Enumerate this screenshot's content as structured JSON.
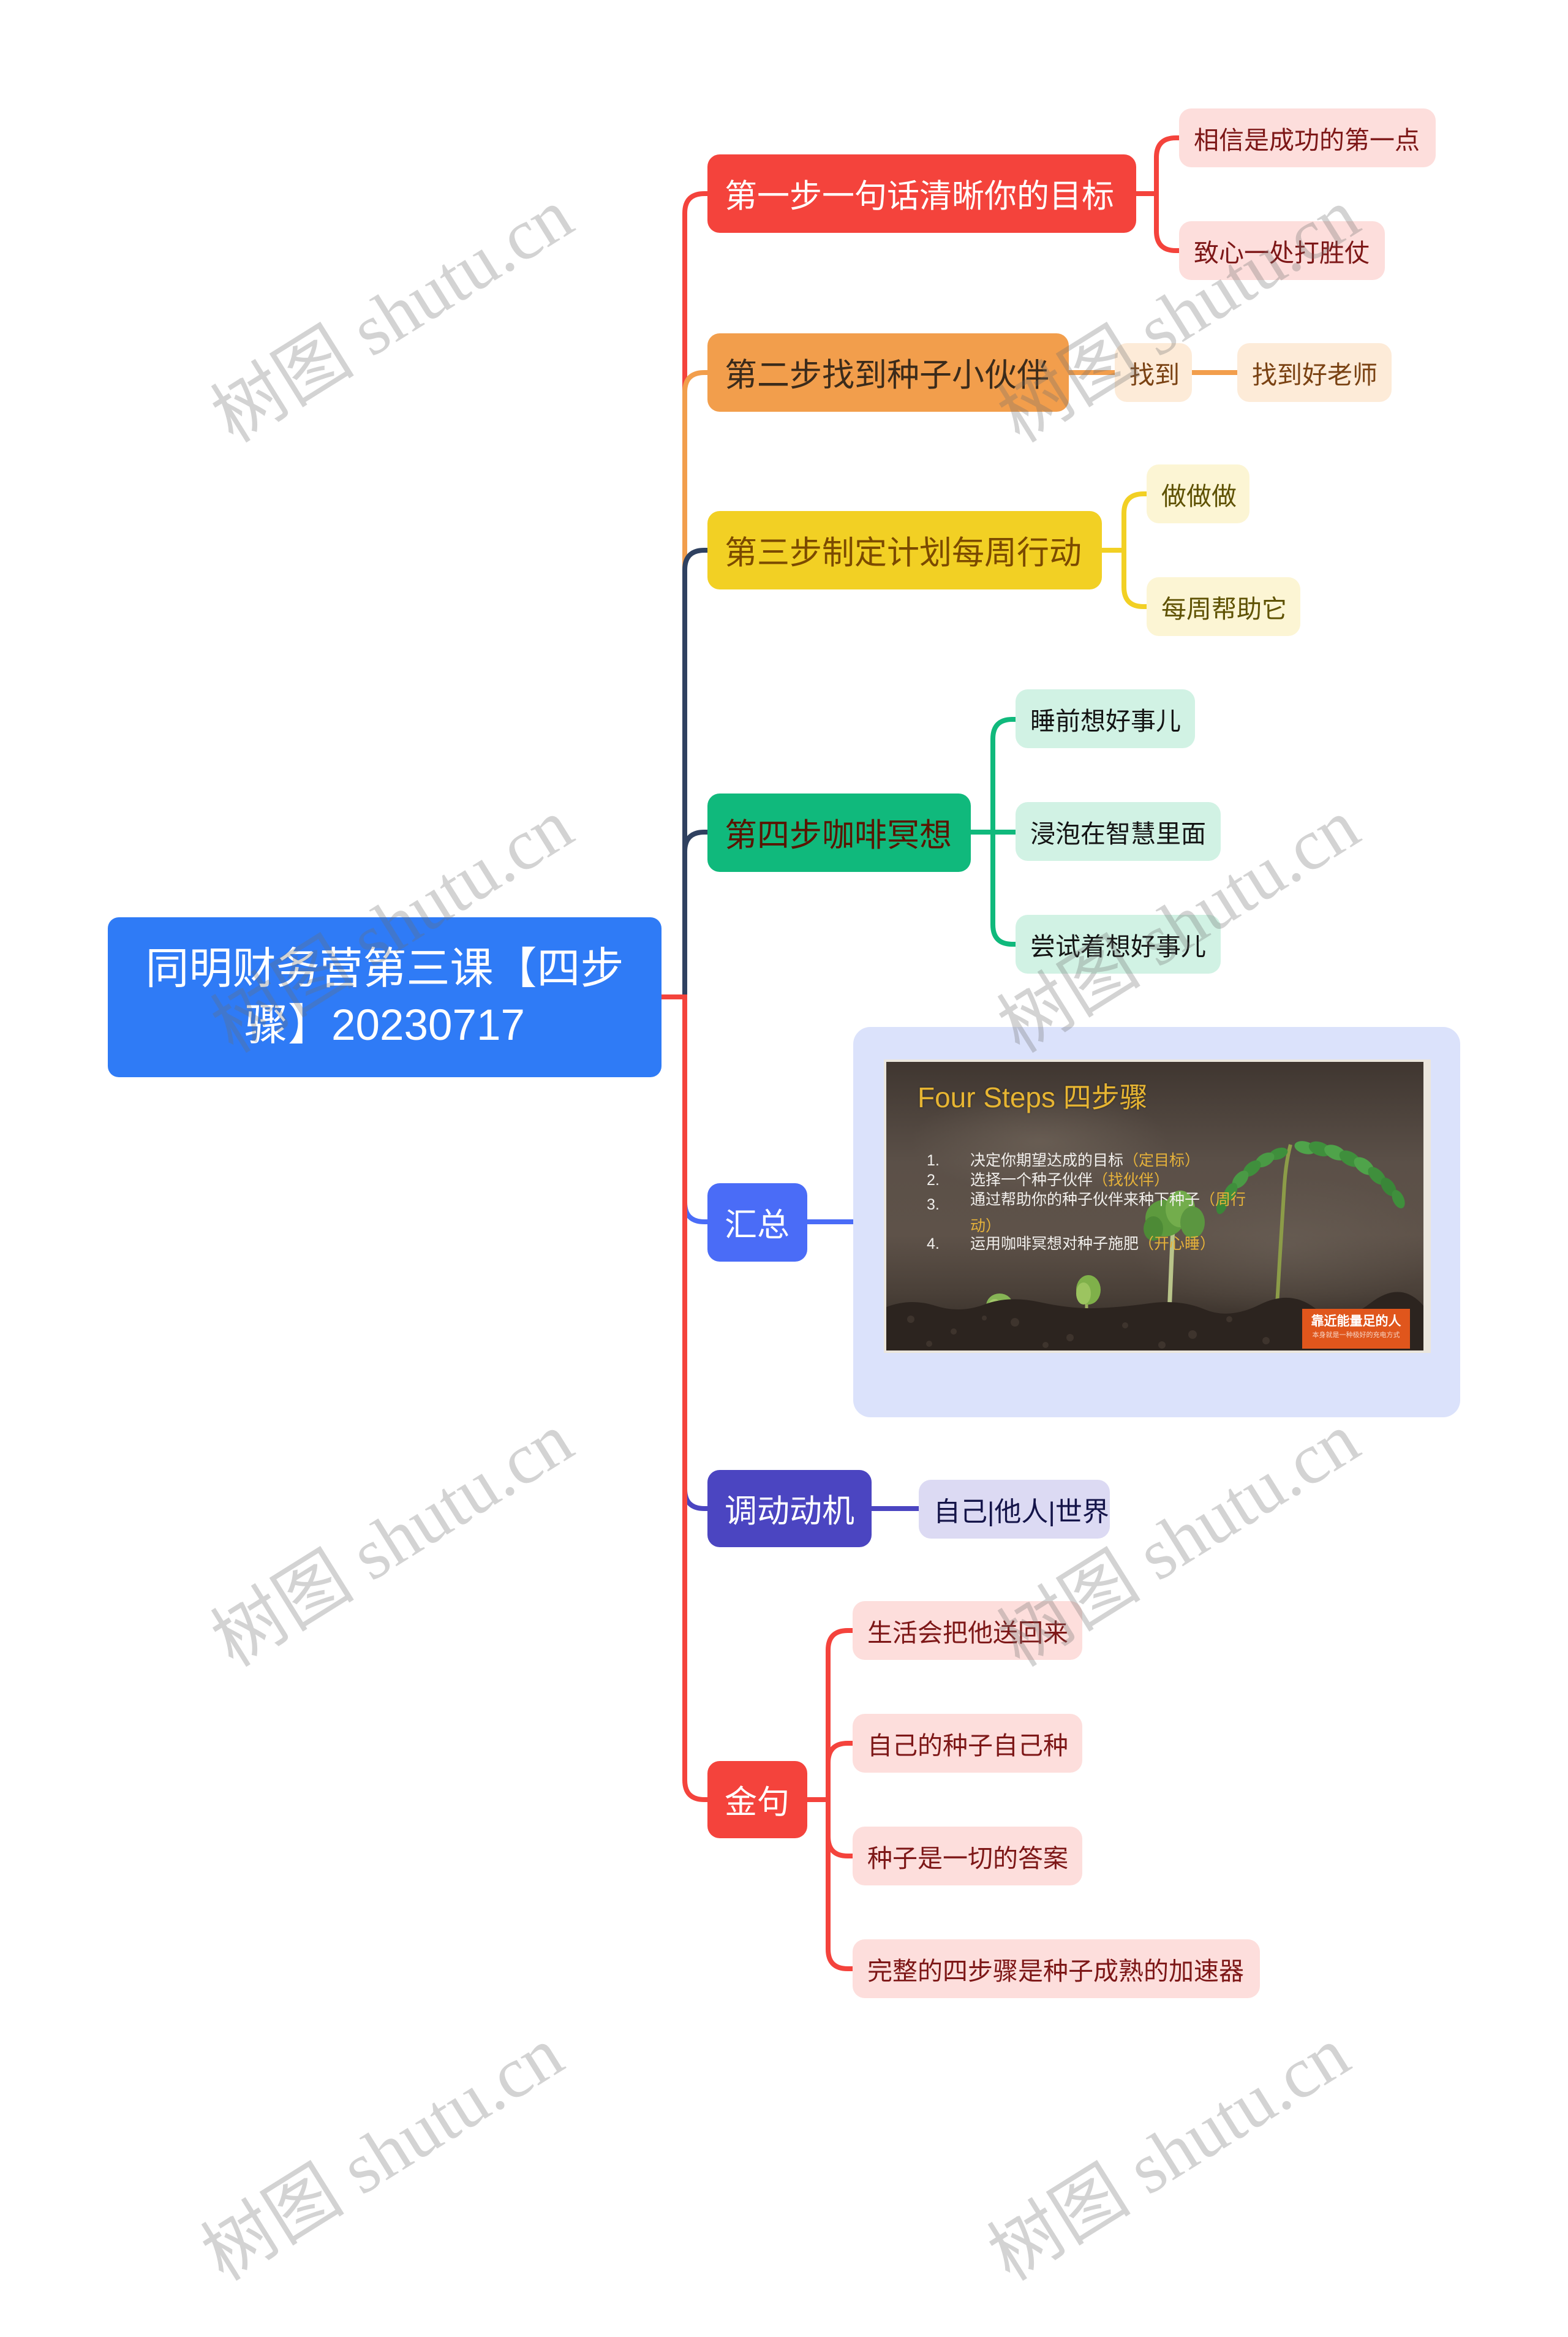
{
  "watermark": {
    "text": "树图 shutu.cn"
  },
  "mindmap": {
    "root": {
      "title_lines": [
        "同明财务营第三课【四步",
        "骤】20230717"
      ],
      "color": "#2f7bf6",
      "label_color": "#ffffff",
      "line_color": "#f4433c"
    },
    "branches": [
      {
        "label": "第一步一句话清晰你的目标",
        "color": "#f4433c",
        "label_color": "#ffffff",
        "line_color": "#f4433c",
        "child_line_color": "#f4433c",
        "leaf_bg": "#fddedc",
        "leaf_text": "#7d1717",
        "children": [
          {
            "label": "相信是成功的第一点"
          },
          {
            "label": "致心一处打胜仗"
          }
        ]
      },
      {
        "label": "第二步找到种子小伙伴",
        "color": "#f29e4c",
        "label_color": "#3b2b1b",
        "line_color": "#f29e4c",
        "child_line_color": "#f29e4c",
        "leaf_bg": "#fdebd8",
        "leaf_text": "#7a4213",
        "children": [
          {
            "label": "找到",
            "children": [
              {
                "label": "找到好老师"
              }
            ]
          }
        ]
      },
      {
        "label": "第三步制定计划每周行动",
        "color": "#f2d024",
        "label_color": "#7b4a00",
        "line_color": "#2f4160",
        "child_line_color": "#f2d024",
        "leaf_bg": "#fcf5d4",
        "leaf_text": "#5f5203",
        "children": [
          {
            "label": "做做做"
          },
          {
            "label": "每周帮助它"
          }
        ]
      },
      {
        "label": "第四步咖啡冥想",
        "color": "#10b97c",
        "label_color": "#5a1500",
        "line_color": "#2f4160",
        "child_line_color": "#10b97c",
        "leaf_bg": "#d1f2e4",
        "leaf_text": "#141414",
        "children": [
          {
            "label": "睡前想好事儿"
          },
          {
            "label": "浸泡在智慧里面"
          },
          {
            "label": "尝试着想好事儿"
          }
        ]
      },
      {
        "label": "汇总",
        "color": "#4a6cf7",
        "label_color": "#ffffff",
        "line_color": "#4a6cf7",
        "child_line_color": "#4a6cf7",
        "leaf_bg": "#dbe2fb",
        "image": {
          "title": "Four Steps 四步骤",
          "title_color": "#e7b532",
          "items": [
            {
              "num": "1.",
              "text": "决定你期望达成的目标",
              "highlight": "（定目标）"
            },
            {
              "num": "2.",
              "text": "选择一个种子伙伴",
              "highlight": "（找伙伴）"
            },
            {
              "num": "3.",
              "text": "通过帮助你的种子伙伴来种下种子",
              "highlight": "（周行动）"
            },
            {
              "num": "4.",
              "text": "运用咖啡冥想对种子施肥",
              "highlight": "（开心睡）"
            }
          ],
          "badge": {
            "title": "靠近能量足的人",
            "subtitle": "本身就是一种极好的充电方式",
            "color": "#e0561c"
          }
        }
      },
      {
        "label": "调动动机",
        "color": "#4b45c1",
        "label_color": "#ffffff",
        "line_color": "#4b45c1",
        "child_line_color": "#4b45c1",
        "leaf_bg": "#dcdaf3",
        "leaf_text": "#141449",
        "children": [
          {
            "label": "自己|他人|世界"
          }
        ]
      },
      {
        "label": "金句",
        "color": "#f4433c",
        "label_color": "#ffffff",
        "line_color": "#f4433c",
        "child_line_color": "#f4433c",
        "leaf_bg": "#fddedc",
        "leaf_text": "#7d1717",
        "children": [
          {
            "label": "生活会把他送回来"
          },
          {
            "label": "自己的种子自己种"
          },
          {
            "label": "种子是一切的答案"
          },
          {
            "label": "完整的四步骤是种子成熟的加速器"
          }
        ]
      }
    ]
  }
}
